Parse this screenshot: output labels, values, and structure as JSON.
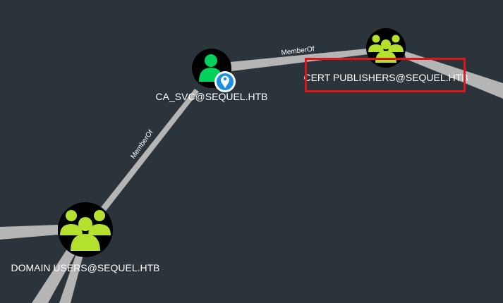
{
  "graph": {
    "edges": [
      {
        "label": "MemberOf"
      },
      {
        "label": "MemberOf"
      }
    ],
    "nodes": {
      "ca_svc": {
        "label": "CA_SVC@SEQUEL.HTB",
        "icon": "user-icon",
        "badge": "location-pin-icon"
      },
      "cert_publishers": {
        "label": "CERT PUBLISHERS@SEQUEL.HTB",
        "icon": "group-icon",
        "highlighted": true
      },
      "domain_users": {
        "label": "DOMAIN USERS@SEQUEL.HTB",
        "icon": "group-icon"
      }
    }
  },
  "colors": {
    "background": "#2b333b",
    "edge": "#b5b5b5",
    "user": "#00d25b",
    "group": "#b4e12d",
    "badge": "#1a8fe3",
    "highlight": "#e0141b"
  }
}
